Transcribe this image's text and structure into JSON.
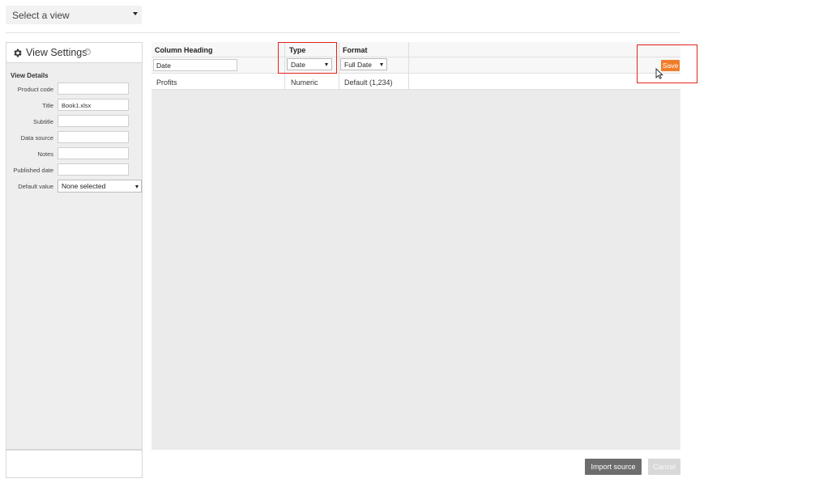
{
  "view_selector": {
    "placeholder": "Select a view"
  },
  "left_panel": {
    "title": "View Settings",
    "help": "?",
    "section_title": "View Details",
    "fields": {
      "product_code": {
        "label": "Product code",
        "value": ""
      },
      "title": {
        "label": "Title",
        "value": "Book1.xlsx"
      },
      "subtitle": {
        "label": "Subtitle",
        "value": ""
      },
      "data_source": {
        "label": "Data source",
        "value": ""
      },
      "notes": {
        "label": "Notes",
        "value": ""
      },
      "published_date": {
        "label": "Published date",
        "value": ""
      },
      "default_value": {
        "label": "Default value",
        "value": "None selected"
      }
    }
  },
  "grid": {
    "headers": {
      "column_heading": "Column Heading",
      "type": "Type",
      "format": "Format"
    },
    "edit_row": {
      "column_heading": "Date",
      "type": "Date",
      "format": "Full Date"
    },
    "rows": [
      {
        "column_heading": "Profits",
        "type": "Numeric",
        "format": "Default (1,234)"
      }
    ]
  },
  "actions": {
    "save": "Save",
    "import_source": "Import source",
    "cancel": "Cancel"
  },
  "colors": {
    "save_button": "#f07d2a",
    "highlight": "#e3221c",
    "import_button": "#6d6d6d",
    "cancel_button": "#d8d8d8"
  }
}
